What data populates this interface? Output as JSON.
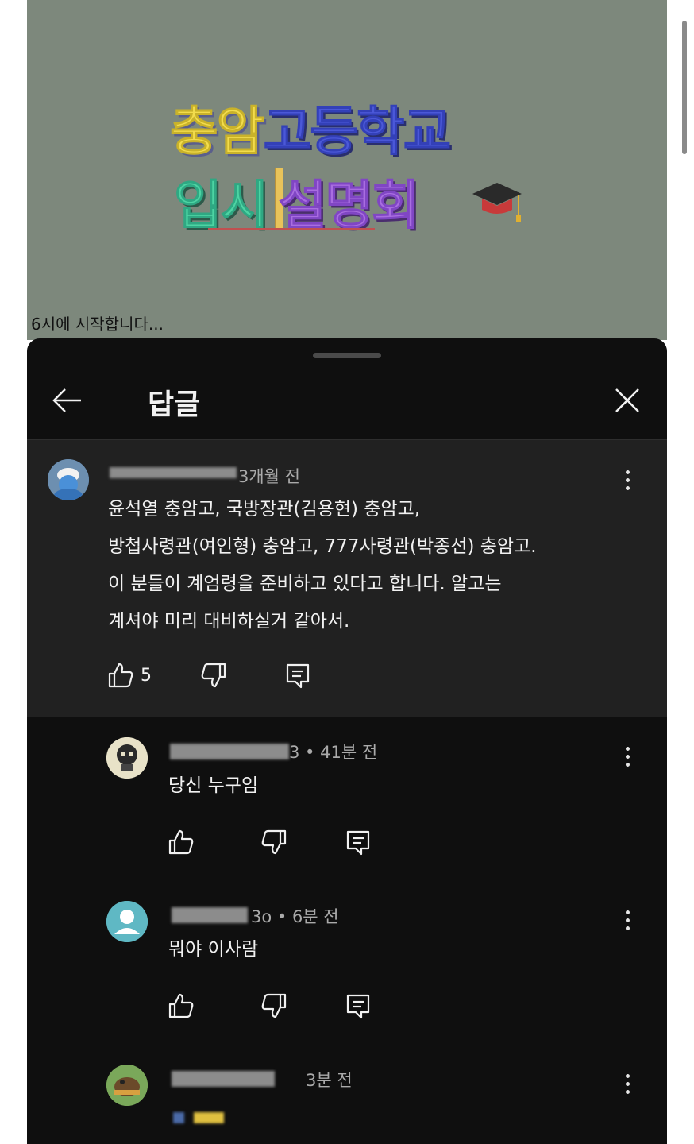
{
  "video": {
    "title_yellow": "충암",
    "title_blue": "고등학교",
    "title_green": "입시",
    "title_purple": "설명회",
    "caption": "6시에 시작합니다...",
    "colors": {
      "background": "#7d887c",
      "yellow": "#f2dc4d",
      "blue": "#4b58d8",
      "green": "#4dd4a3",
      "purple": "#a96ee0"
    }
  },
  "sheet": {
    "title": "답글",
    "back_icon": "arrow-left-icon",
    "close_icon": "close-icon",
    "colors": {
      "background": "#0f0f0f",
      "highlight": "#212121",
      "text": "#f1f1f1",
      "meta": "#aaaaaa"
    }
  },
  "parent_comment": {
    "time": "3개월 전",
    "lines": [
      "윤석열 충암고, 국방장관(김용현) 충암고,",
      "방첩사령관(여인형) 충암고, 777사령관(박종선) 충암고.",
      "이 분들이 계엄령을 준비하고 있다고 합니다. 알고는",
      "계셔야 미리 대비하실거 같아서."
    ],
    "like_count": "5"
  },
  "replies": [
    {
      "meta": "3 • 41분 전",
      "text": "당신 누구임"
    },
    {
      "meta": "3o • 6분 전",
      "text": "뭐야 이사람"
    },
    {
      "meta": "3분 전",
      "text": ""
    }
  ]
}
